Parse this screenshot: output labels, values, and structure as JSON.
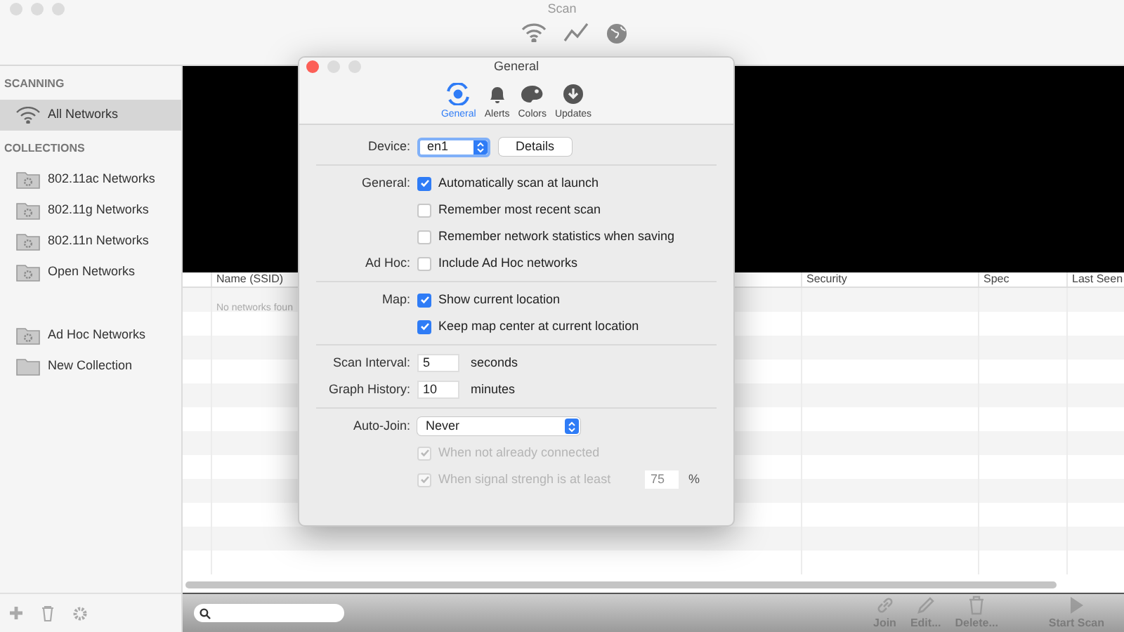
{
  "window": {
    "title": "Scan"
  },
  "sidebar": {
    "sections": [
      {
        "title": "SCANNING",
        "items": [
          {
            "label": "All Networks",
            "kind": "wifi",
            "selected": true
          }
        ]
      },
      {
        "title": "COLLECTIONS",
        "items": [
          {
            "label": "802.11ac Networks",
            "kind": "smart-folder",
            "selected": false
          },
          {
            "label": "802.11g Networks",
            "kind": "smart-folder",
            "selected": false
          },
          {
            "label": "802.11n Networks",
            "kind": "smart-folder",
            "selected": false
          },
          {
            "label": "Open Networks",
            "kind": "smart-folder",
            "selected": false
          },
          {
            "label": "Ad Hoc Networks",
            "kind": "smart-folder",
            "selected": false
          },
          {
            "label": "New Collection",
            "kind": "folder",
            "selected": false
          }
        ]
      }
    ]
  },
  "table": {
    "columns": [
      "Name (SSID)",
      "Security",
      "Spec",
      "Last Seen"
    ],
    "empty_message": "No networks foun"
  },
  "bottom_bar": {
    "buttons": [
      {
        "label": "Join",
        "kind": "link",
        "disabled": true
      },
      {
        "label": "Edit...",
        "kind": "edit",
        "disabled": true
      },
      {
        "label": "Delete...",
        "kind": "delete",
        "disabled": true
      },
      {
        "label": "Start Scan",
        "kind": "play",
        "disabled": true
      }
    ]
  },
  "dialog": {
    "title": "General",
    "tabs": [
      {
        "label": "General",
        "kind": "general",
        "selected": true
      },
      {
        "label": "Alerts",
        "kind": "alerts",
        "selected": false
      },
      {
        "label": "Colors",
        "kind": "colors",
        "selected": false
      },
      {
        "label": "Updates",
        "kind": "updates",
        "selected": false
      }
    ],
    "groups": [
      [
        {
          "label": "Device:",
          "kind": "device",
          "value": "en1",
          "button": "Details"
        }
      ],
      [
        {
          "label": "General:",
          "kind": "checkbox",
          "text": "Automatically scan at launch",
          "checked": true,
          "disabled": false
        },
        {
          "kind": "checkbox",
          "text": "Remember most recent scan",
          "checked": false,
          "disabled": false
        },
        {
          "kind": "checkbox",
          "text": "Remember network statistics when saving",
          "checked": false,
          "disabled": false
        },
        {
          "label": "Ad Hoc:",
          "kind": "checkbox",
          "text": "Include Ad Hoc networks",
          "checked": false,
          "disabled": false
        }
      ],
      [
        {
          "label": "Map:",
          "kind": "checkbox",
          "text": "Show current location",
          "checked": true,
          "disabled": false
        },
        {
          "kind": "checkbox",
          "text": "Keep map center at current location",
          "checked": true,
          "disabled": false
        }
      ],
      [
        {
          "label": "Scan Interval:",
          "kind": "number",
          "value": "5",
          "unit": "seconds"
        },
        {
          "label": "Graph History:",
          "kind": "number",
          "value": "10",
          "unit": "minutes"
        }
      ],
      [
        {
          "label": "Auto-Join:",
          "kind": "select",
          "value": "Never"
        },
        {
          "kind": "checkbox",
          "text": "When not already connected",
          "checked": true,
          "disabled": true
        },
        {
          "kind": "checkbox",
          "text": "When signal strengh is at least",
          "checked": true,
          "disabled": true,
          "value": "75",
          "unit": "%"
        }
      ]
    ]
  }
}
